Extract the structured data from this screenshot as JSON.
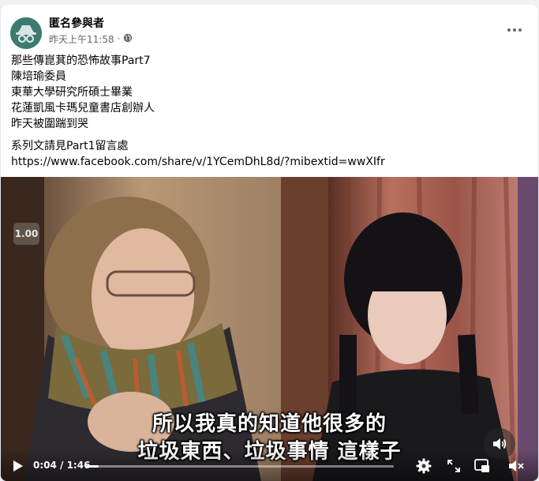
{
  "post": {
    "author": "匿名參與者",
    "timestamp": "昨天上午11:58",
    "separator": "·",
    "privacy_icon": "globe-icon",
    "more_icon": "more-dots-icon",
    "lines": [
      "那些傳崑萁的恐怖故事Part7",
      "陳培瑜委員",
      "東華大學研究所碩士畢業",
      "花蓮凱風卡瑪兒童書店創辦人",
      "昨天被圍踹到哭"
    ],
    "footer_line": "系列文請見Part1留言處",
    "link": "https://www.facebook.com/share/v/1YCemDhL8d/?mibextid=wwXIfr"
  },
  "video": {
    "speed": "1.00",
    "subtitle_line1": "所以我真的知道他很多的",
    "subtitle_line2": "垃圾東西、垃圾事情 這樣子",
    "time": "0:04 / 1:46",
    "progress_fraction": 0.04,
    "icons": {
      "play": "play-icon",
      "volume_big": "volume-icon",
      "settings": "gear-icon",
      "fullscreen": "fullscreen-icon",
      "pip": "picture-in-picture-icon",
      "mute": "mute-icon"
    }
  },
  "colors": {
    "author_text": "#050505",
    "meta_text": "#65676b",
    "card_bg": "#ffffff",
    "page_bg": "#f0f2f5"
  }
}
